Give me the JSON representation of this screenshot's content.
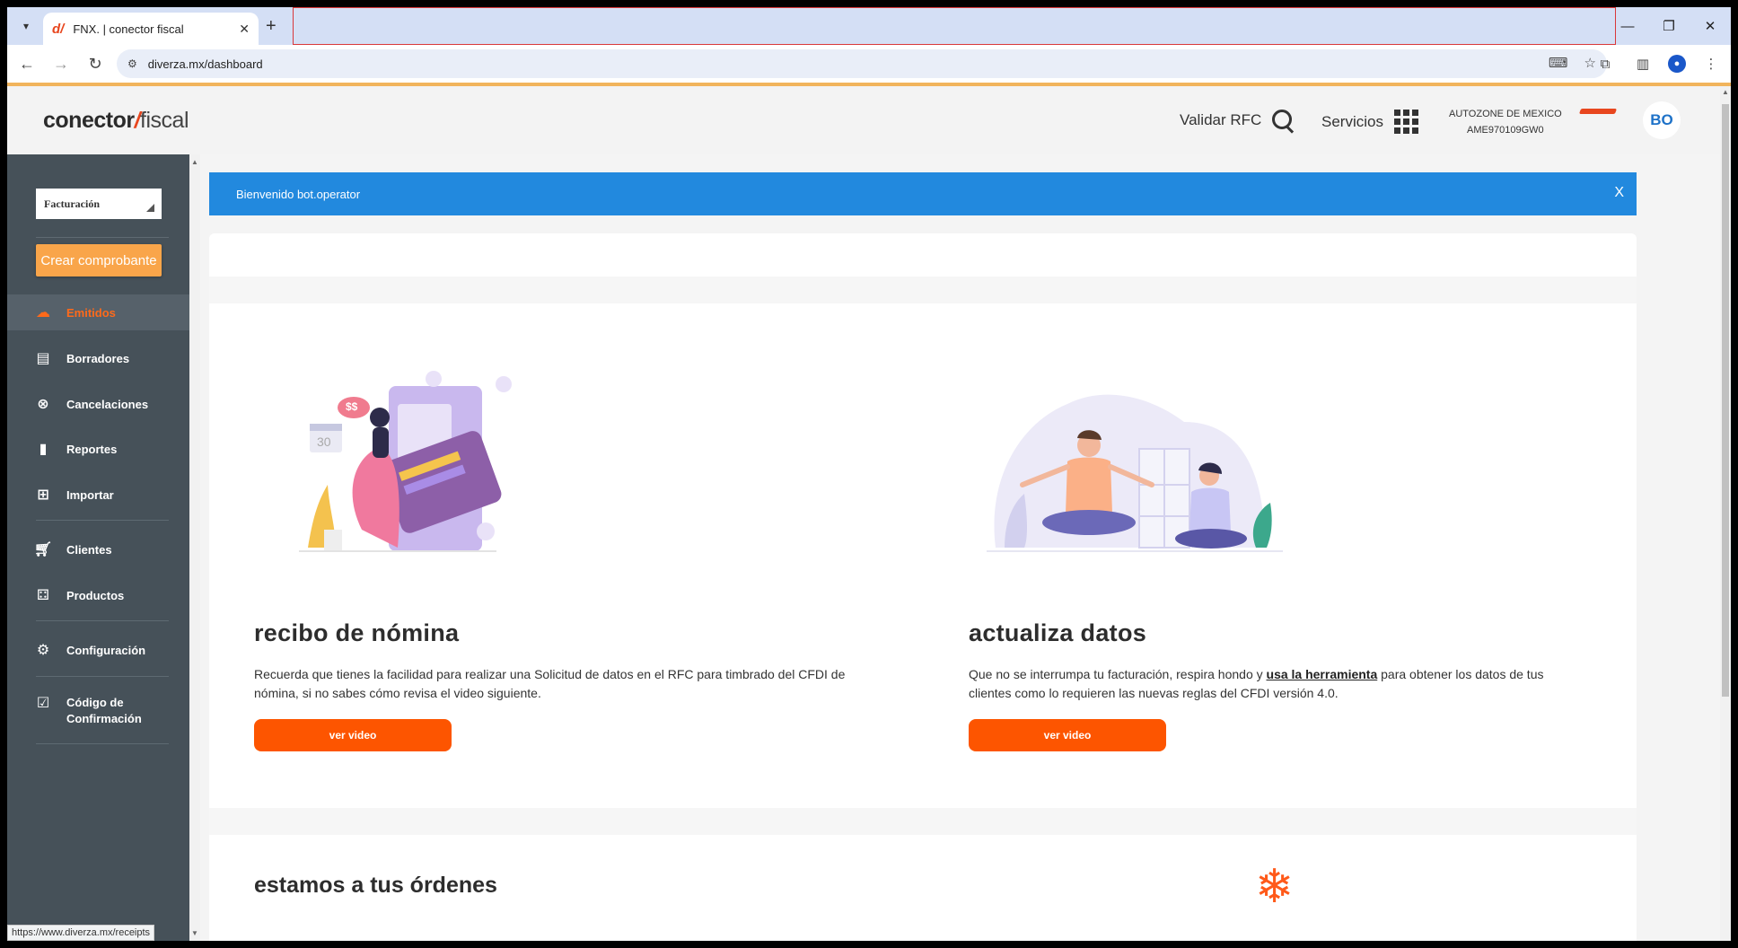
{
  "browser": {
    "tab_title": "FNX. | conector fiscal",
    "tab_favicon": "d/",
    "url": "diverza.mx/dashboard",
    "status_url": "https://www.diverza.mx/receipts"
  },
  "header": {
    "logo_bold": "conector",
    "logo_slash": "/",
    "logo_light": "fiscal",
    "validar_label": "Validar RFC",
    "servicios_label": "Servicios",
    "company_name": "AUTOZONE DE MEXICO",
    "company_rfc": "AME970109GW0",
    "avatar_initials": "BO"
  },
  "sidebar": {
    "select_value": "Facturación",
    "create_button": "Crear comprobante",
    "items": [
      {
        "label": "Emitidos",
        "icon": "cloud-upload-icon",
        "active": true
      },
      {
        "label": "Borradores",
        "icon": "clipboard-icon"
      },
      {
        "label": "Cancelaciones",
        "icon": "cancel-circle-icon"
      },
      {
        "label": "Reportes",
        "icon": "bar-chart-icon"
      },
      {
        "label": "Importar",
        "icon": "import-icon"
      },
      {
        "label": "Clientes",
        "icon": "cart-icon"
      },
      {
        "label": "Productos",
        "icon": "boxes-icon"
      },
      {
        "label": "Configuración",
        "icon": "gear-icon"
      },
      {
        "label": "Código de",
        "label2": "Confirmación",
        "icon": "checkbox-icon"
      }
    ]
  },
  "banner": {
    "text": "Bienvenido bot.operator",
    "close": "X"
  },
  "cards": [
    {
      "title": "recibo de nómina",
      "text": "Recuerda que tienes la facilidad para realizar una Solicitud de datos en el RFC para timbrado del CFDI de nómina, si no sabes cómo revisa el video siguiente.",
      "button": "ver video",
      "illustration_label": "$$",
      "calendar_label": "30"
    },
    {
      "title": "actualiza datos",
      "text_before": "Que no se interrumpa tu facturación, respira hondo y ",
      "text_link": "usa la herramienta",
      "text_after": " para obtener los datos de tus clientes como lo requieren las nuevas reglas del CFDI versión 4.0.",
      "button": "ver video"
    }
  ],
  "orders": {
    "title": "estamos a tus órdenes"
  },
  "colors": {
    "accent_orange": "#fd5500",
    "banner_blue": "#2289de",
    "sidebar_bg": "#465159",
    "create_button": "#f9a54a"
  }
}
